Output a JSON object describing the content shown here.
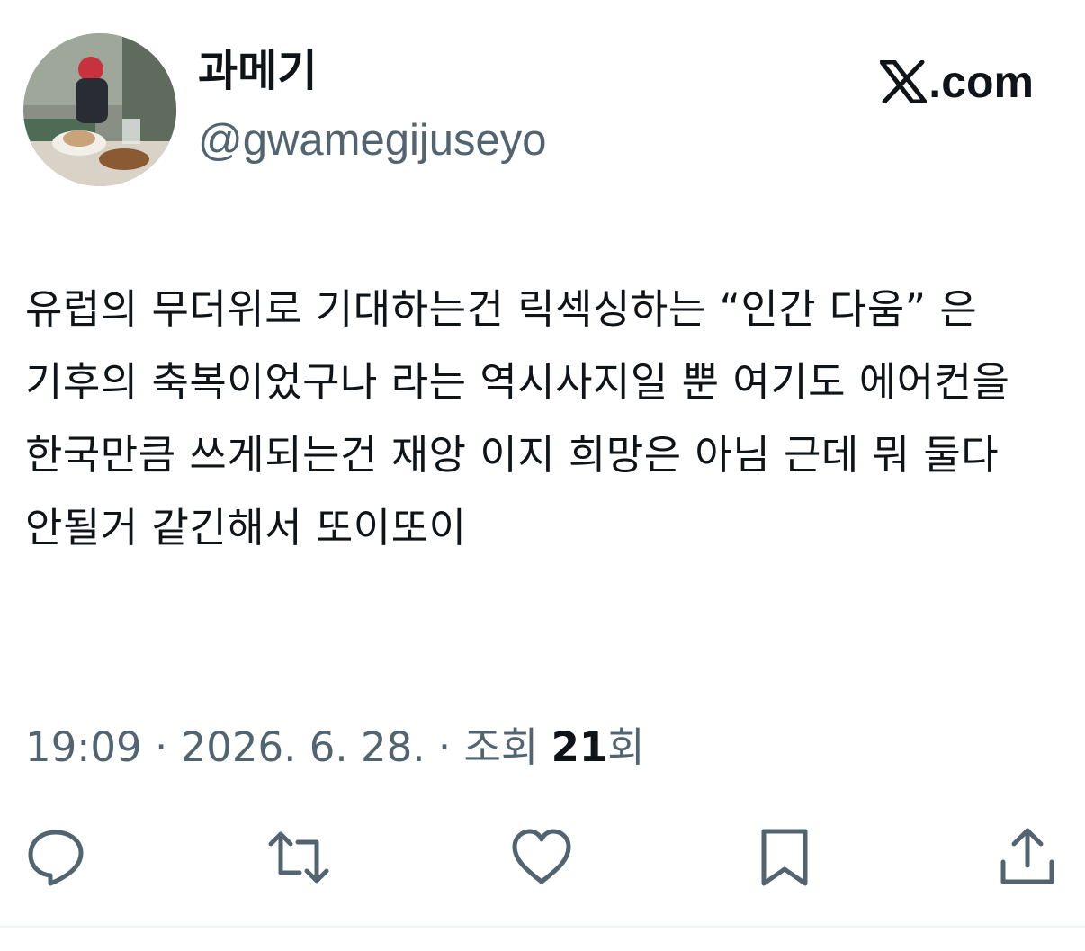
{
  "author": {
    "display_name": "과메기",
    "handle": "@gwamegijuseyo",
    "avatar": "cafe-table-photo"
  },
  "brand": {
    "icon": "x-logo-icon",
    "suffix": ".com"
  },
  "tweet": {
    "text": "유럽의 무더위로 기대하는건 릭섹싱하는 “인간 다움” 은 기후의 축복이었구나 라는 역시사지일 뿐 여기도 에어컨을 한국만큼 쓰게되는건 재앙 이지 희망은 아님 근데 뭐 둘다 안될거 같긴해서 또이또이"
  },
  "meta": {
    "time": "19:09",
    "separator": " · ",
    "date": "2026. 6. 28.",
    "views_prefix": "조회 ",
    "views_count": "21",
    "views_suffix": "회"
  },
  "actions": [
    {
      "name": "reply",
      "icon": "reply-icon"
    },
    {
      "name": "retweet",
      "icon": "retweet-icon"
    },
    {
      "name": "like",
      "icon": "heart-icon"
    },
    {
      "name": "bookmark",
      "icon": "bookmark-icon"
    },
    {
      "name": "share",
      "icon": "share-icon"
    }
  ],
  "colors": {
    "text_primary": "#0f1419",
    "text_secondary": "#536471",
    "divider": "#eff3f4"
  }
}
